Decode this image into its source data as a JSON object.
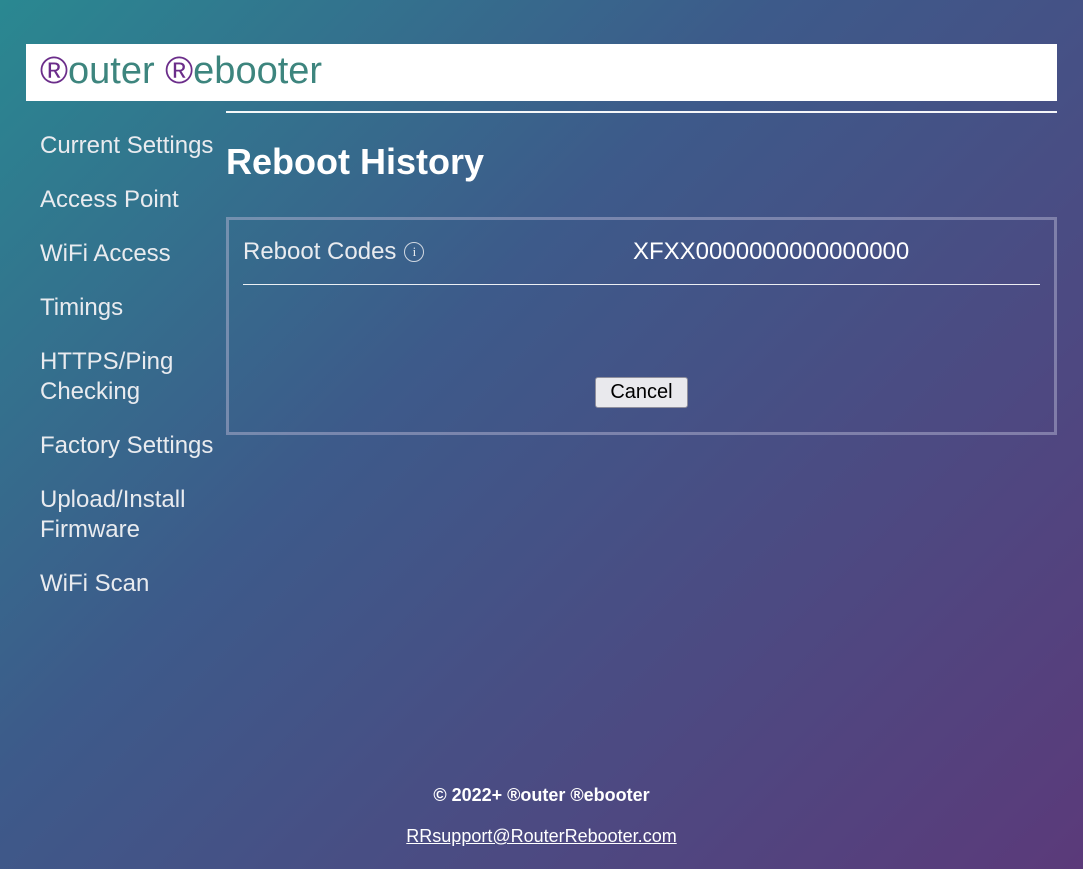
{
  "brand": {
    "r1": "®",
    "word1": "outer ",
    "r2": "®",
    "word2": "ebooter"
  },
  "sidebar": {
    "items": [
      {
        "label": "Current Settings"
      },
      {
        "label": "Access Point"
      },
      {
        "label": "WiFi Access"
      },
      {
        "label": "Timings"
      },
      {
        "label": "HTTPS/Ping Checking"
      },
      {
        "label": "Factory Settings"
      },
      {
        "label": "Upload/Install Firmware"
      },
      {
        "label": "WiFi Scan"
      }
    ]
  },
  "page": {
    "title": "Reboot History"
  },
  "panel": {
    "row_label": "Reboot Codes",
    "row_value": "XFXX0000000000000000",
    "cancel_label": "Cancel"
  },
  "footer": {
    "copyright": "© 2022+ ®outer ®ebooter",
    "support_email": "RRsupport@RouterRebooter.com"
  }
}
